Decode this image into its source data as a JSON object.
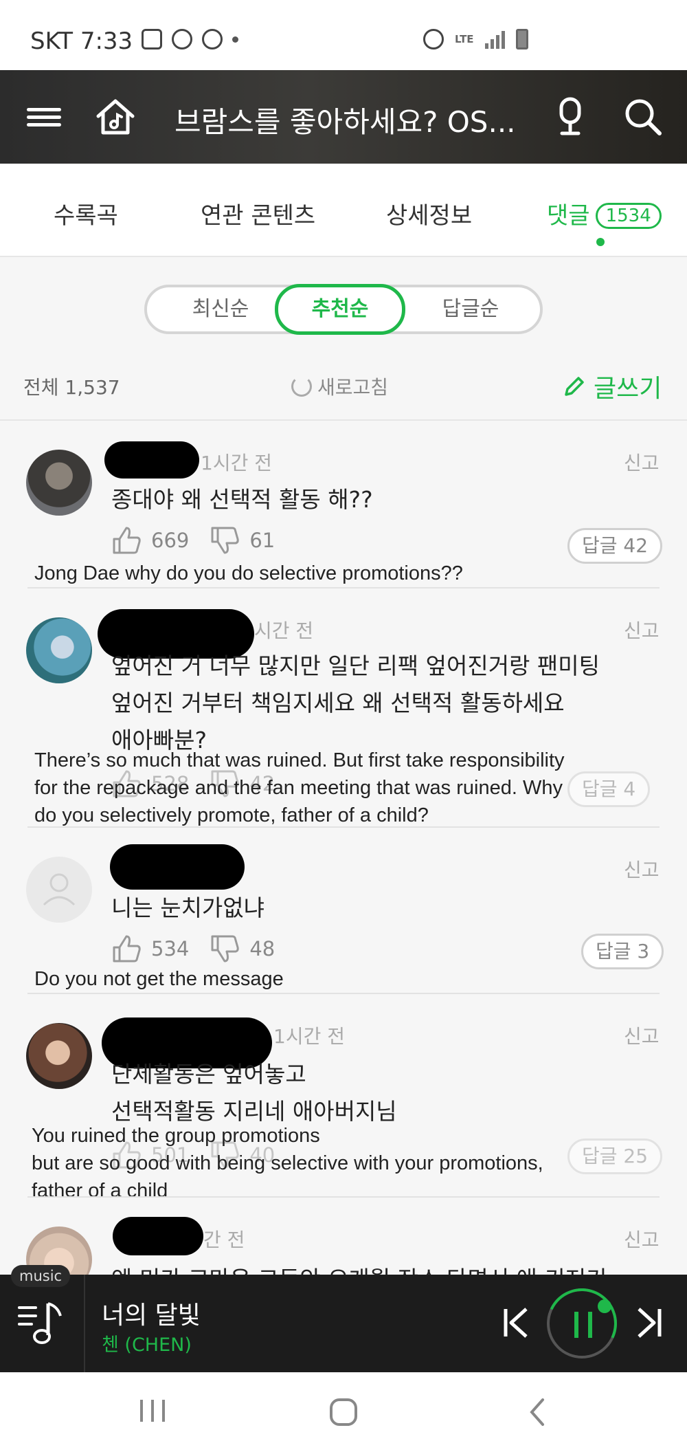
{
  "status_bar": {
    "carrier": "SKT 7:33",
    "lte": "LTE",
    "icons": [
      "gallery-icon",
      "camera-icon",
      "talk-icon",
      "dot-icon",
      "alarm-icon",
      "signal-icon",
      "battery-icon"
    ]
  },
  "header": {
    "title": "브람스를 좋아하세요? OS..."
  },
  "tabs": [
    {
      "label": "수록곡"
    },
    {
      "label": "연관 콘텐츠"
    },
    {
      "label": "상세정보"
    },
    {
      "label": "댓글",
      "count": "1534",
      "active": true
    }
  ],
  "sort": {
    "options": [
      "최신순",
      "추천순",
      "답글순"
    ],
    "selected": "추천순"
  },
  "meta": {
    "total": "전체 1,537",
    "refresh": "새로고침",
    "write": "글쓰기"
  },
  "comments": [
    {
      "time": "1시간 전",
      "report": "신고",
      "text": [
        "종대야 왜 선택적 활동 해??"
      ],
      "likes": "669",
      "dislikes": "61",
      "replies": "답글 42",
      "translation": [
        "Jong Dae why do you do selective promotions??"
      ]
    },
    {
      "time": "시간 전",
      "report": "신고",
      "text": [
        "엎어진 거 너무 많지만 일단 리팩 엎어진거랑 팬미팅",
        "엎어진 거부터 책임지세요 왜 선택적 활동하세요",
        "애아빠분?"
      ],
      "likes": "528",
      "dislikes": "42",
      "replies": "답글 4",
      "translation": [
        "There’s so much that was ruined. But first take responsibility",
        "for the repackage and the fan meeting that was ruined. Why",
        "do you selectively promote, father of a child?"
      ]
    },
    {
      "time": "",
      "report": "신고",
      "text": [
        "니는 눈치가없냐"
      ],
      "likes": "534",
      "dislikes": "48",
      "replies": "답글 3",
      "translation": [
        "Do you not get the message"
      ]
    },
    {
      "time": "1시간 전",
      "report": "신고",
      "text": [
        "단체활동은 엎어놓고",
        "선택적활동 지리네 애아버지님"
      ],
      "likes": "501",
      "dislikes": "40",
      "replies": "답글 25",
      "translation": [
        "You ruined the group promotions",
        "but are so good with being selective with your promotions,",
        "father of a child"
      ]
    },
    {
      "time": "간 전",
      "report": "신고",
      "text": [
        "엔 미가 고마은 그동안 오개월 잔소 타면서 애 키저기"
      ]
    }
  ],
  "player": {
    "badge": "music",
    "song": "너의 달빛",
    "artist": "첸 (CHEN)",
    "progress": 0.12,
    "accent": "#1fb84a"
  }
}
